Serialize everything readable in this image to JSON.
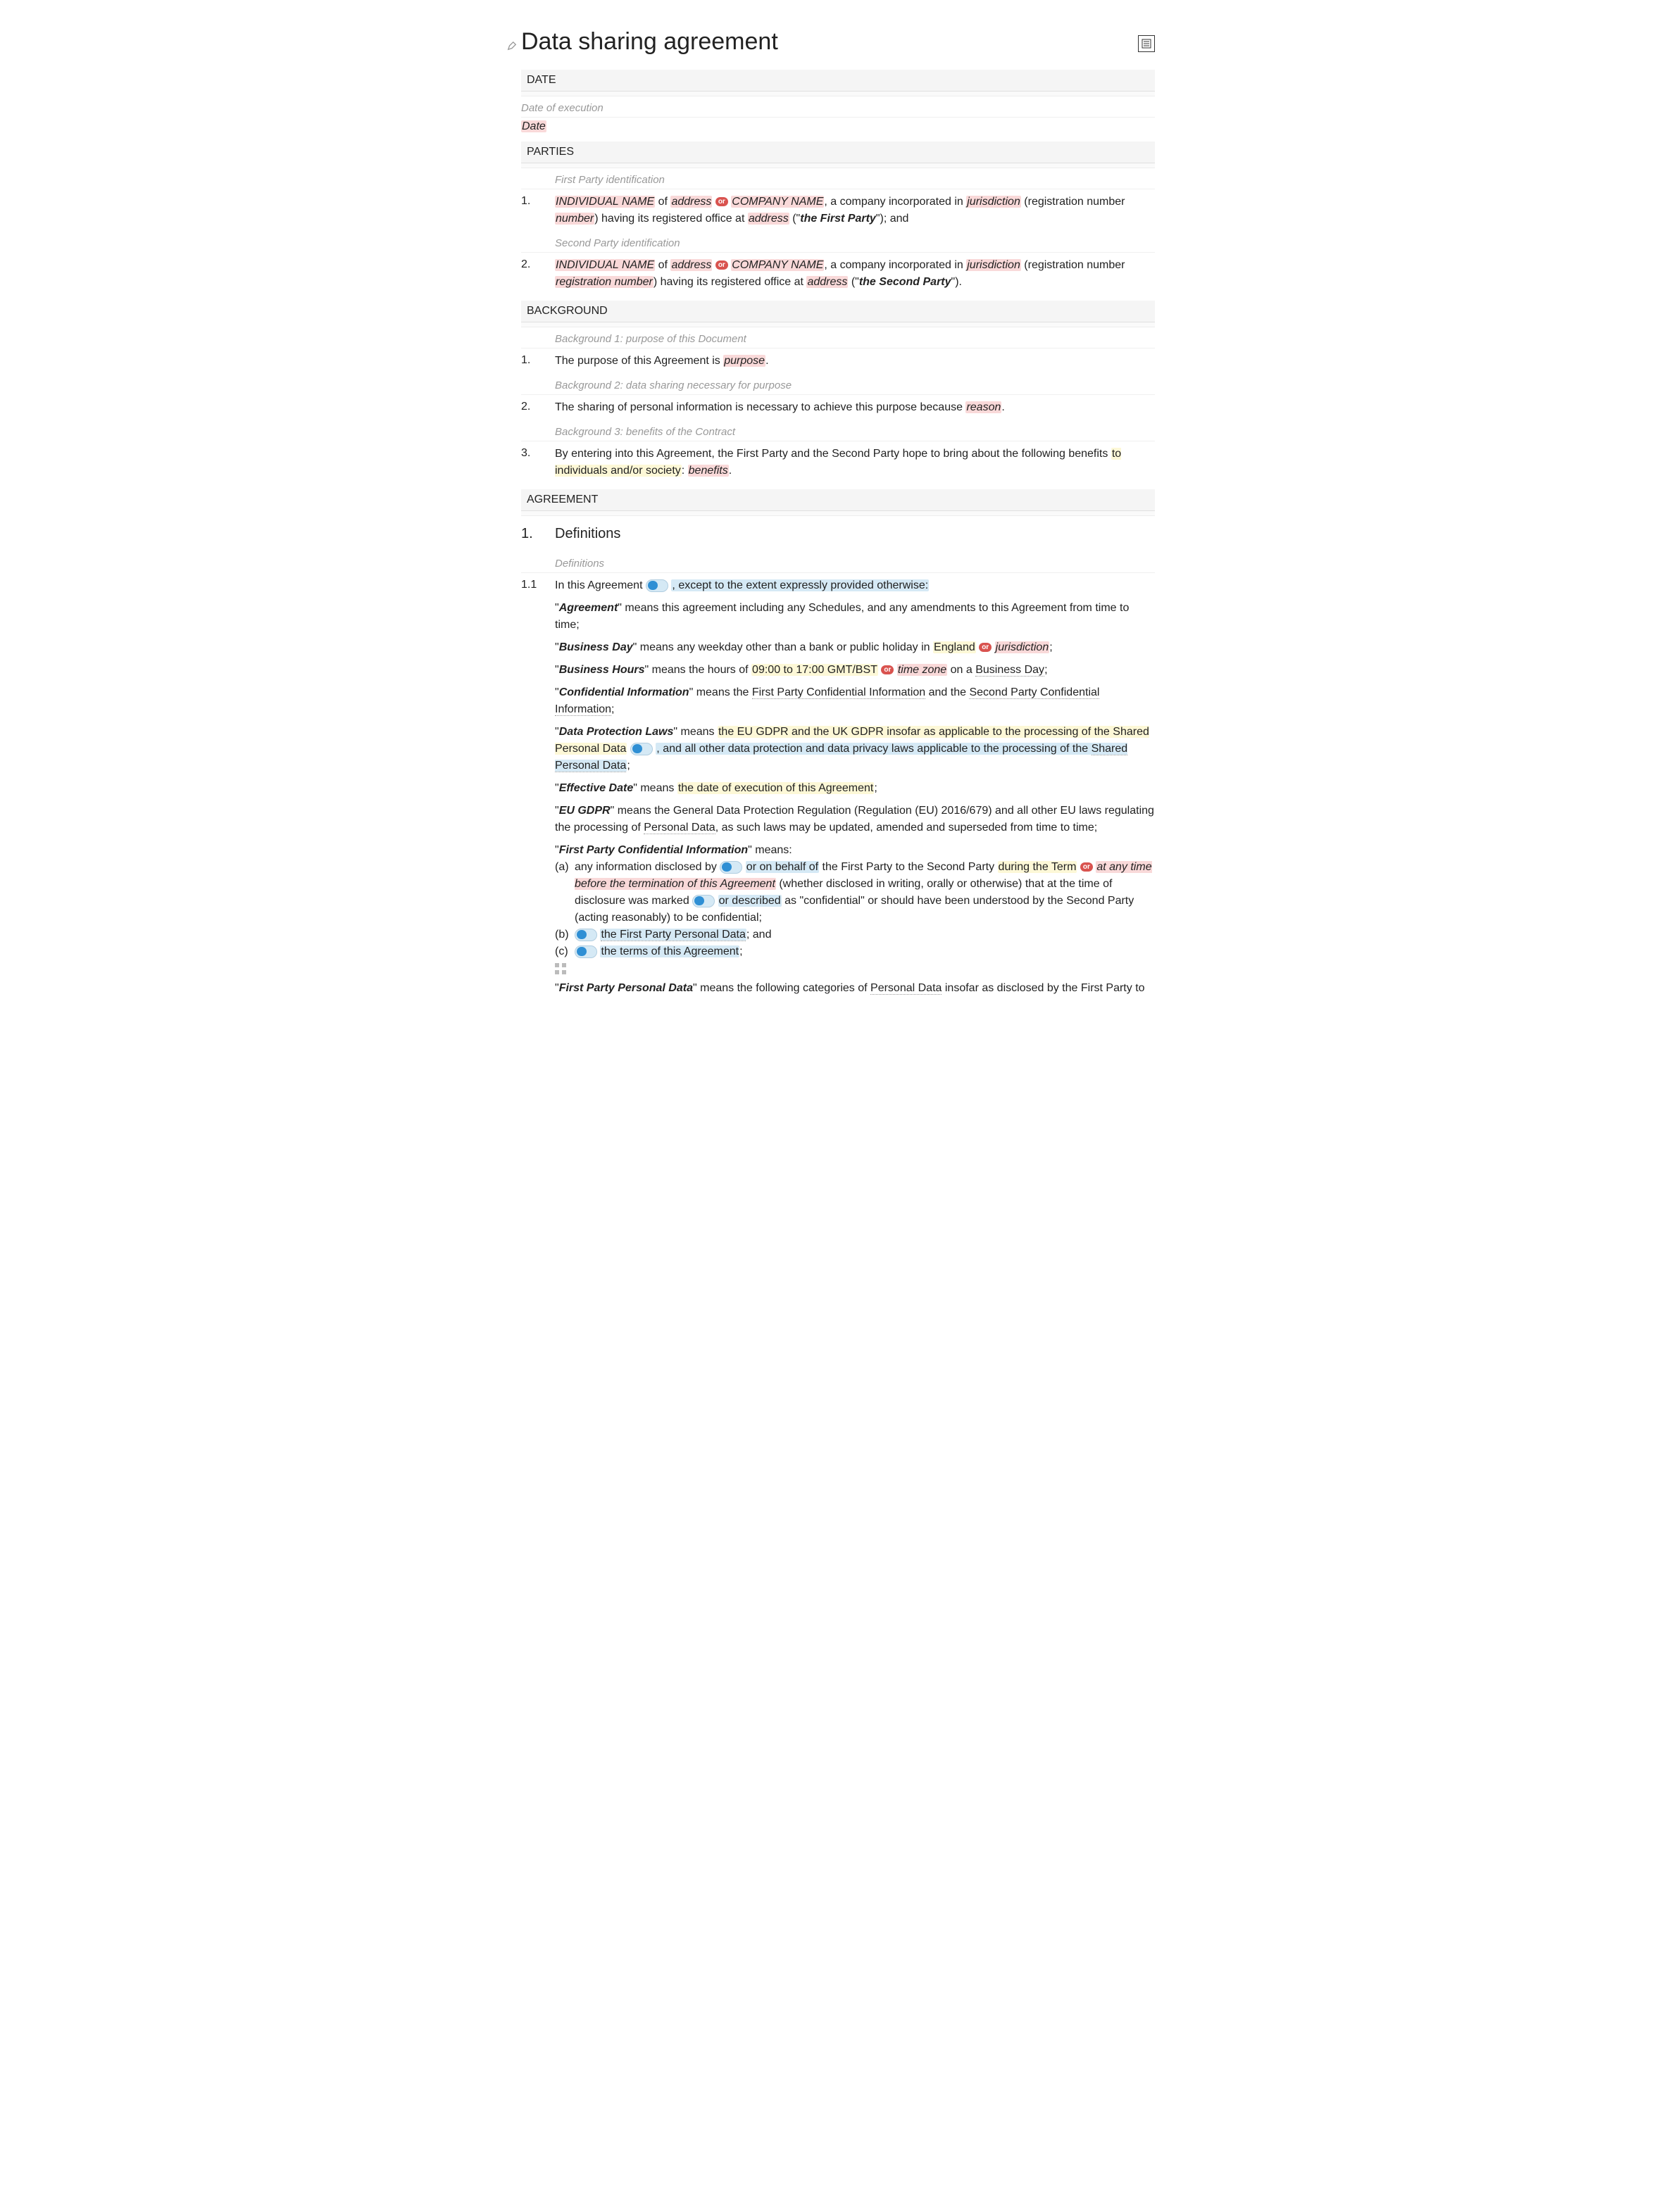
{
  "title": "Data sharing agreement",
  "sections": {
    "date": {
      "header": "DATE",
      "note": "Date of execution",
      "placeholder": "Date"
    },
    "parties": {
      "header": "PARTIES",
      "note1": "First Party identification",
      "note2": "Second Party identification",
      "individual_name": "INDIVIDUAL NAME",
      "of": "of",
      "address": "address",
      "or": "or",
      "company_name": "COMPANY NAME",
      "company_text1": ", a company incorporated in ",
      "jurisdiction": "jurisdiction",
      "reg_open": " (registration number ",
      "number": "number",
      "reg_number": "registration number",
      "reg_close": ") having its registered office at ",
      "first_party_label": "the First Party",
      "second_party_label": "the Second Party",
      "and": "\"); and",
      "close2": "\")."
    },
    "background": {
      "header": "BACKGROUND",
      "note1": "Background 1: purpose of this Document",
      "text1a": "The purpose of this Agreement is ",
      "purpose": "purpose",
      "note2": "Background 2: data sharing necessary for purpose",
      "text2a": "The sharing of personal information is necessary to achieve this purpose because ",
      "reason": "reason",
      "note3": "Background 3: benefits of the Contract",
      "text3a": "By entering into this Agreement, the First Party and the Second Party hope to bring about the following benefits ",
      "text3b": "to individuals and/or society",
      "benefits": "benefits"
    },
    "agreement": {
      "header": "AGREEMENT"
    }
  },
  "definitions": {
    "header_num": "1.",
    "header_text": "Definitions",
    "note": "Definitions",
    "sub_num": "1.1",
    "intro_a": "In this Agreement",
    "intro_b": ", except to the extent expressly provided otherwise:",
    "or": "or",
    "agreement": {
      "term": "Agreement",
      "text": "\" means this agreement including any Schedules, and any amendments to this Agreement from time to time;"
    },
    "business_day": {
      "term": "Business Day",
      "text1": "\" means any weekday other than a bank or public holiday in ",
      "england": "England",
      "jurisdiction": "jurisdiction"
    },
    "business_hours": {
      "term": "Business Hours",
      "text1": "\" means the hours of ",
      "hours": "09:00 to 17:00 GMT/BST",
      "tz": "time zone",
      "text2": " on a ",
      "bd": "Business Day"
    },
    "confidential": {
      "term": "Confidential Information",
      "text1": "\" means the ",
      "fp": "First Party Confidential Information",
      "and": " and the ",
      "sp": "Second Party Confidential Information"
    },
    "dpl": {
      "term": "Data Protection Laws",
      "text1": "\" means ",
      "part_a": "the EU GDPR and the UK GDPR insofar as applicable to the processing of the Shared Personal Data",
      "part_b": ", and all other data protection and data privacy laws applicable to the processing of the ",
      "spd": "Shared Personal Data"
    },
    "effective": {
      "term": "Effective Date",
      "text1": "\" means ",
      "val": "the date of execution of this Agreement"
    },
    "eu_gdpr": {
      "term": "EU GDPR",
      "text1": "\" means the General Data Protection Regulation (Regulation (EU) 2016/679) and all other EU laws regulating the processing of ",
      "pd": "Personal Data",
      "text2": ", as such laws may be updated, amended and superseded from time to time;"
    },
    "fpci": {
      "term": "First Party Confidential Information",
      "means": "\" means:",
      "a_pre": "any information disclosed by",
      "a_mid": "or on behalf of",
      "a_1": " the First Party to the Second Party ",
      "a_term": "during the Term",
      "a_alt": "at any time before the termination of this Agreement",
      "a_2": " (whether disclosed in writing, orally or otherwise) that at the time of disclosure was marked ",
      "a_desc": "or described",
      "a_3": " as \"confidential\" or should have been understood by the Second Party (acting reasonably) to be confidential;",
      "b": "the First Party Personal Data",
      "b_and": "; and",
      "c": "the terms of this Agreement"
    },
    "fppd": {
      "term": "First Party Personal Data",
      "text1": "\" means the following categories of ",
      "pd": "Personal Data",
      "text2": " insofar as disclosed by the First Party to"
    }
  }
}
